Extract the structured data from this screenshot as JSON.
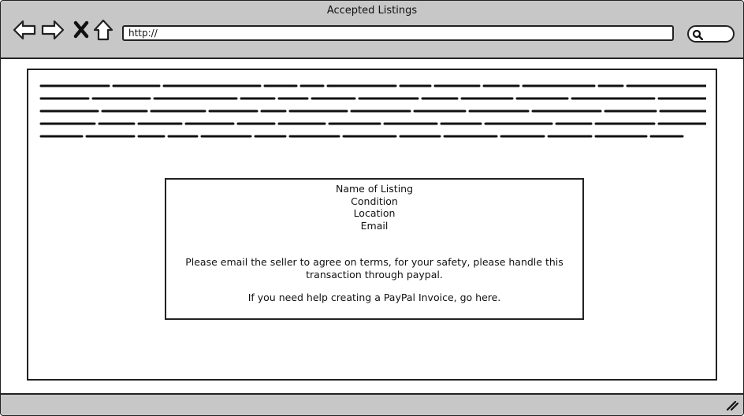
{
  "window": {
    "title": "Accepted Listings"
  },
  "toolbar": {
    "back_icon": "arrow-left-icon",
    "forward_icon": "arrow-right-icon",
    "stop_icon": "close-icon",
    "home_icon": "home-icon",
    "url": "http://",
    "search_icon": "search-icon"
  },
  "listing": {
    "name_label": "Name of Listing",
    "condition_label": "Condition",
    "location_label": "Location",
    "email_label": "Email",
    "instructions": "Please email the seller to agree on terms, for your safety, please handle this transaction through paypal.",
    "help_text": "If you need help creating a PayPal Invoice, go here."
  }
}
